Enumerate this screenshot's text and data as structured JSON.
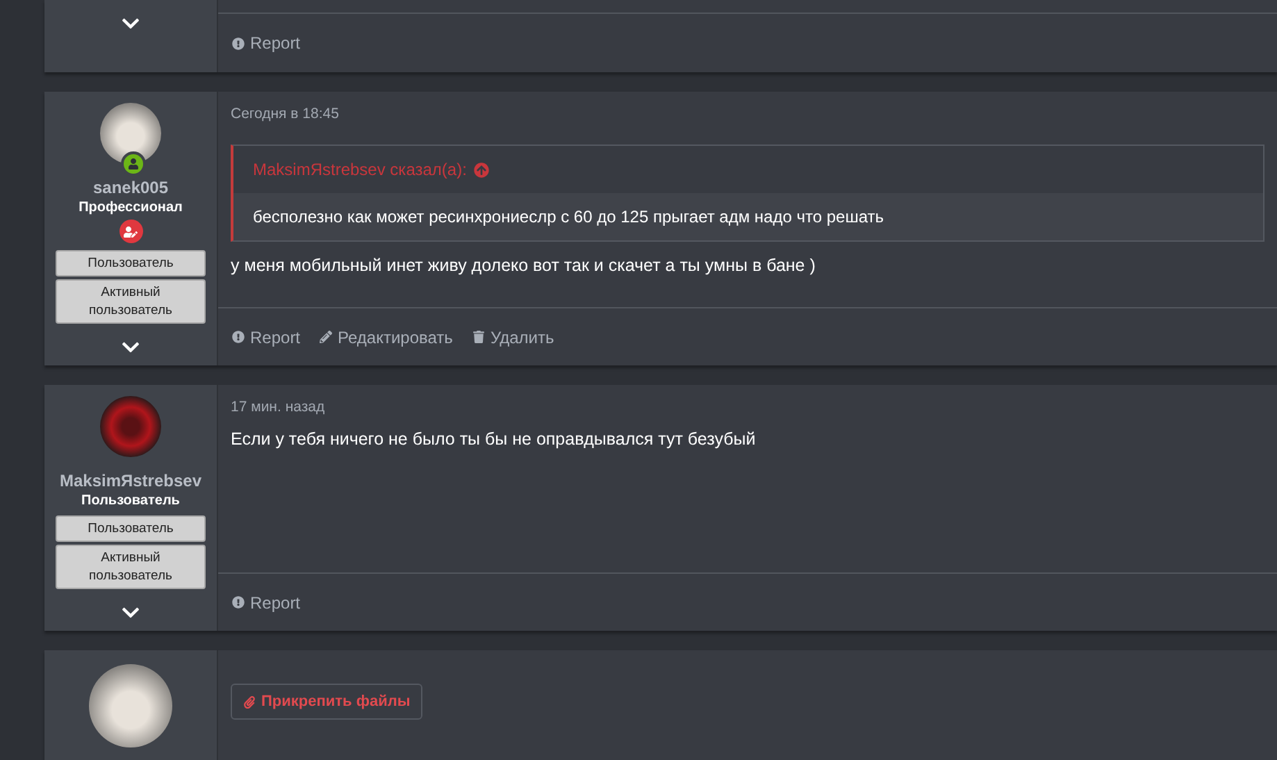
{
  "posts": [
    {
      "kind": "tail",
      "actions": [
        {
          "kind": "report",
          "label": "Report"
        }
      ]
    },
    {
      "kind": "post",
      "user": {
        "name": "sanek005",
        "title": "Профессионал",
        "online": true,
        "staff_badge": true,
        "banners": [
          "Пользователь",
          "Активный пользователь"
        ]
      },
      "time": "Сегодня в 18:45",
      "quote": {
        "author": "MaksimЯstrebsev сказал(а):",
        "text": "бесполезно как может ресинхрониеслр с 60 до 125 прыгает адм надо что решать"
      },
      "message": "у меня мобильный инет живу долеко вот так и скачет а ты умны в бане )",
      "actions": [
        {
          "kind": "report",
          "label": "Report"
        },
        {
          "kind": "edit",
          "label": "Редактировать"
        },
        {
          "kind": "delete",
          "label": "Удалить"
        }
      ]
    },
    {
      "kind": "post",
      "user": {
        "name": "MaksimЯstrebsev",
        "title": "Пользователь",
        "online": false,
        "staff_badge": false,
        "banners": [
          "Пользователь",
          "Активный пользователь"
        ]
      },
      "time": "17 мин. назад",
      "message": "Если у тебя ничего не было ты бы не оправдывался тут безубый",
      "actions": [
        {
          "kind": "report",
          "label": "Report"
        }
      ]
    },
    {
      "kind": "reply",
      "button": "Прикрепить файлы"
    }
  ]
}
